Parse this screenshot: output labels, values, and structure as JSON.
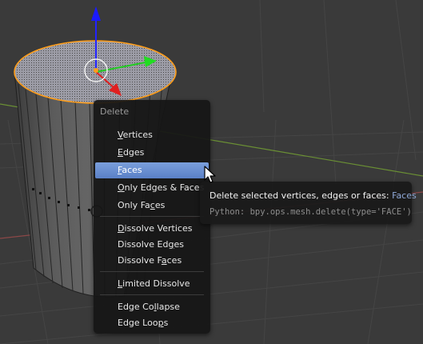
{
  "menu": {
    "title": "Delete",
    "items": [
      {
        "underline": "V",
        "rest": "ertices"
      },
      {
        "underline": "E",
        "rest": "dges"
      },
      {
        "underline": "F",
        "rest": "aces"
      },
      {
        "pre": "",
        "underline": "O",
        "rest": "nly Edges & Faces"
      },
      {
        "pre": "Only Fa",
        "underline": "c",
        "rest": "es"
      },
      {
        "underline": "D",
        "rest": "issolve Vertices"
      },
      {
        "pre": "Dissolve Ed",
        "underline": "g",
        "rest": "es"
      },
      {
        "pre": "Dissolve F",
        "underline": "a",
        "rest": "ces"
      },
      {
        "underline": "L",
        "rest": "imited Dissolve"
      },
      {
        "pre": "Edge Co",
        "underline": "l",
        "rest": "lapse"
      },
      {
        "pre": "Edge Loo",
        "underline": "p",
        "rest": "s"
      }
    ],
    "selected_index": 2
  },
  "tooltip": {
    "description": "Delete selected vertices, edges or faces:",
    "value": "Faces",
    "python": "Python: bpy.ops.mesh.delete(type='FACE')"
  },
  "colors": {
    "background": "#3a3a3a",
    "grid": "#444444",
    "x_axis": "#a04a4a",
    "y_axis": "#7aa03a",
    "z_axis": "#1a1aff",
    "gizmo_y": "#22cc22",
    "gizmo_x": "#e02020",
    "selection_outline": "#ff9e1a",
    "menu_highlight": "#5a80c6"
  },
  "icons": {
    "gizmo": "transform-manipulator-icon",
    "cursor": "mouse-pointer-icon",
    "pivot": "pivot-point-icon"
  }
}
